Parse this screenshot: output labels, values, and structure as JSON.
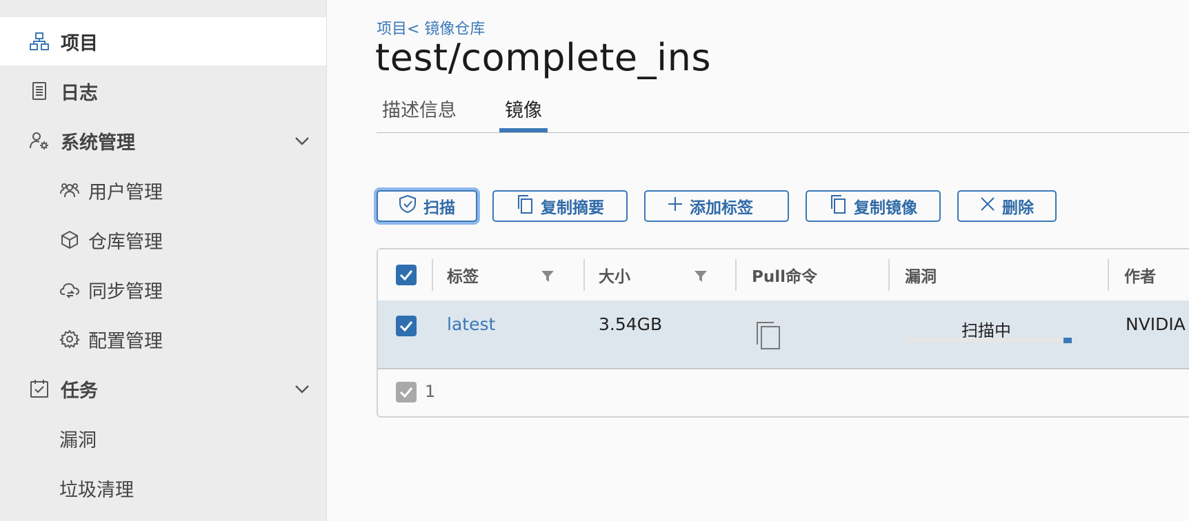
{
  "sidebar": {
    "items": [
      {
        "label": "项目",
        "icon": "project-icon"
      },
      {
        "label": "日志",
        "icon": "log-icon"
      },
      {
        "label": "系统管理",
        "icon": "admin-icon"
      },
      {
        "label": "任务",
        "icon": "task-icon"
      }
    ],
    "admin_sub": [
      {
        "label": "用户管理",
        "icon": "users-icon"
      },
      {
        "label": "仓库管理",
        "icon": "box-icon"
      },
      {
        "label": "同步管理",
        "icon": "cloud-sync-icon"
      },
      {
        "label": "配置管理",
        "icon": "gear-icon"
      }
    ],
    "task_sub": [
      {
        "label": "漏洞"
      },
      {
        "label": "垃圾清理"
      }
    ]
  },
  "breadcrumb": "项目< 镜像仓库",
  "page_title": "test/complete_ins",
  "tabs": [
    {
      "label": "描述信息"
    },
    {
      "label": "镜像"
    }
  ],
  "toolbar": {
    "scan": "扫描",
    "copy_digest": "复制摘要",
    "add_label": "添加标签",
    "copy_image": "复制镜像",
    "delete": "删除"
  },
  "table": {
    "columns": [
      "标签",
      "大小",
      "Pull命令",
      "漏洞",
      "作者"
    ],
    "rows": [
      {
        "tag": "latest",
        "size": "3.54GB",
        "vulnerability": "扫描中",
        "scan_progress": 0.05,
        "author": "NVIDIA"
      }
    ],
    "footer_count": "1"
  },
  "colors": {
    "accent": "#3a78b8",
    "sidebar_bg": "#ececec",
    "row_selected": "#dde5ed"
  }
}
